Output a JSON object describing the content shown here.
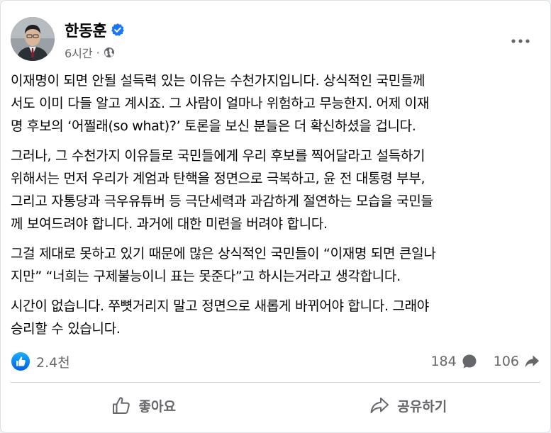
{
  "post": {
    "author": "한동훈",
    "verified": true,
    "time": "6시간",
    "separator": "·",
    "audience_icon": "globe-icon",
    "menu_icon": "more-horizontal-icon",
    "paragraphs": [
      "이재명이 되면 안될 설득력 있는 이유는 수천가지입니다. 상식적인 국민들께\n서도 이미 다들 알고 계시죠. 그 사람이 얼마나 위험하고 무능한지. 어제 이재\n명 후보의 ‘어쩔래(so what)?’ 토론을 보신 분들은 더 확신하셨을 겁니다.",
      "그러나, 그 수천가지 이유들로 국민들에게 우리 후보를 찍어달라고 설득하기\n위해서는 먼저 우리가 계엄과 탄핵을 정면으로 극복하고, 윤 전 대통령 부부,\n그리고 자통당과 극우유튜버 등 극단세력과 과감하게 절연하는 모습을 국민들\n께 보여드려야 합니다. 과거에 대한 미련을 버려야 합니다.",
      "그걸 제대로 못하고 있기 때문에 많은 상식적인 국민들이 “이재명 되면 큰일나\n지만”  “너희는 구제불능이니 표는 못준다”고 하시는거라고 생각합니다.",
      "시간이 없습니다. 쭈뼛거리지 말고 정면으로 새롭게 바뀌어야 합니다. 그래야\n승리할 수 있습니다."
    ]
  },
  "stats": {
    "reactions": "2.4천",
    "comments": "184",
    "shares": "106"
  },
  "actions": {
    "like_label": "좋아요",
    "share_label": "공유하기"
  },
  "colors": {
    "brand_blue": "#1877f2",
    "secondary_text": "#65676b",
    "primary_text": "#050505"
  }
}
